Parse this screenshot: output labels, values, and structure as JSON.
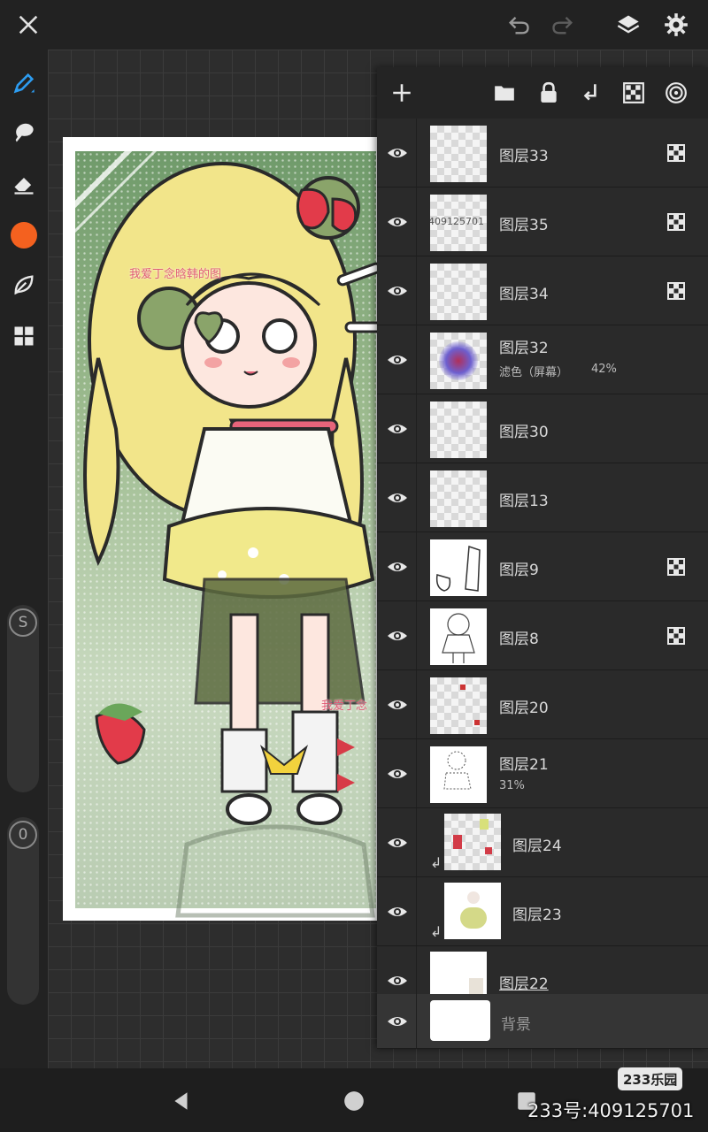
{
  "top_bar": {
    "close_icon": "close-icon",
    "undo_icon": "undo-icon",
    "redo_icon": "redo-icon",
    "layers_icon": "layers-icon",
    "settings_icon": "gear-icon"
  },
  "tools": {
    "brush": "pen-icon",
    "smudge": "smudge-icon",
    "eraser": "eraser-icon",
    "current_color": "#f4611f",
    "leaf": "leaf-icon",
    "grid": "panels-icon"
  },
  "sliders": {
    "size_label": "S",
    "opacity_label": "0"
  },
  "artwork": {
    "watermark_1": "我爱丁念晗韩的图",
    "watermark_2": "我爱丁念",
    "id_text_small": "409125701"
  },
  "layers_toolbar": {
    "add": "plus-icon",
    "group": "folder-icon",
    "lock": "lock-icon",
    "merge_down": "merge-down-icon",
    "alpha": "checker-icon",
    "reference": "target-icon"
  },
  "layers": [
    {
      "name": "图层33",
      "alpha_lock": true
    },
    {
      "name": "图层35",
      "alpha_lock": true,
      "thumb_text": "409125701"
    },
    {
      "name": "图层34",
      "alpha_lock": true
    },
    {
      "name": "图层32",
      "blend": "滤色（屏幕）",
      "opacity": "42%"
    },
    {
      "name": "图层30"
    },
    {
      "name": "图层13"
    },
    {
      "name": "图层9",
      "alpha_lock": true
    },
    {
      "name": "图层8",
      "alpha_lock": true
    },
    {
      "name": "图层20"
    },
    {
      "name": "图层21",
      "opacity": "31%"
    },
    {
      "name": "图层24",
      "clipped": true
    },
    {
      "name": "图层23",
      "clipped": true
    },
    {
      "name": "图层22",
      "selected_text": true
    },
    {
      "name": "背景"
    }
  ],
  "watermark": {
    "badge": "233乐园",
    "id": "233号:409125701"
  }
}
